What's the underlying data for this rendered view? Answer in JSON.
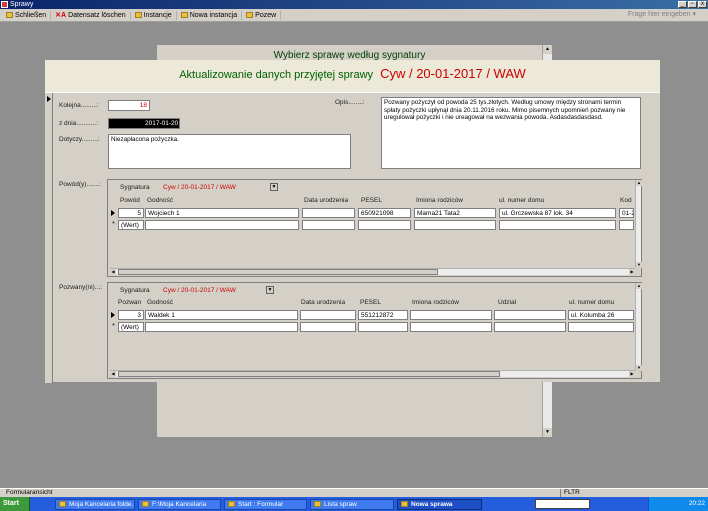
{
  "window": {
    "title": "Sprawy"
  },
  "menubar": {
    "items": [
      "Schließen",
      "Datensatz löschen",
      "Instancje",
      "Nowa instancja",
      "Pozew"
    ],
    "help_placeholder": "Frage hier eingeben"
  },
  "background_form": {
    "title": "Wybierz sprawę według sygnatury"
  },
  "form": {
    "title": "Aktualizowanie danych przyjętej sprawy",
    "signature": "Cyw / 20-01-2017 / WAW",
    "kolejna_label": "Kolejna.........:",
    "kolejna_value": "18",
    "zdnia_label": "z dnia...........:",
    "zdnia_value": "2017-01-20",
    "dotyczy_label": "Dotyczy.........:",
    "dotyczy_value": "Niezapłacona pożyczka.",
    "opis_label": "Opis........:",
    "opis_value": "Pozwany pożyczył od powoda 25 tys.złotych. Według umowy między stronami termin spłaty pożyczki upłynął dnia 20.11.2016 roku. Mimo pisemnych upomnień pozwany nie uregulował pożyczki i nie ureagował na wezwania powoda. Asdasdasdasdasd.",
    "powod_label": "Powód(y).......:",
    "pozwany_label": "Pozwany(ni)...:"
  },
  "powod_sub": {
    "sygnatura_label": "Sygnatura",
    "sygnatura_value": "Cyw / 20-01-2017 / WAW",
    "headers": [
      "Powód",
      "Godność",
      "Data urodzenia",
      "PESEL",
      "Imiona rodziców",
      "ul. numer domu",
      "Kod"
    ],
    "row": {
      "id": "5",
      "name": "Wojciech 1",
      "birth": "",
      "pesel": "650921098",
      "parents": "Mama21 Tata2",
      "address": "ul. Grczewska 87 lok. 34",
      "code": "01-2"
    },
    "new_row": "(Wert)"
  },
  "pozwany_sub": {
    "sygnatura_label": "Sygnatura",
    "sygnatura_value": "Cyw / 20-01-2017 / WAW",
    "headers": [
      "Pozwan",
      "Godność",
      "Data urodzenia",
      "PESEL",
      "Imiona rodziców",
      "Udział",
      "ul. numer domu"
    ],
    "row": {
      "id": "3",
      "name": "Waldek 1",
      "birth": "",
      "pesel": "551212872",
      "parents": "",
      "share": "",
      "address": "ul. Kolumba 26"
    },
    "new_row": "(Wert)"
  },
  "statusbar": {
    "left": "Formularansicht",
    "right": "FLTR"
  },
  "taskbar": {
    "start": "Start",
    "items": [
      "Moja Kancelaria folde...",
      "F:\\Moja Kancelaria",
      "Start : Formular",
      "Lista spraw",
      "Nowa sprawa"
    ],
    "clock": "20:22"
  }
}
